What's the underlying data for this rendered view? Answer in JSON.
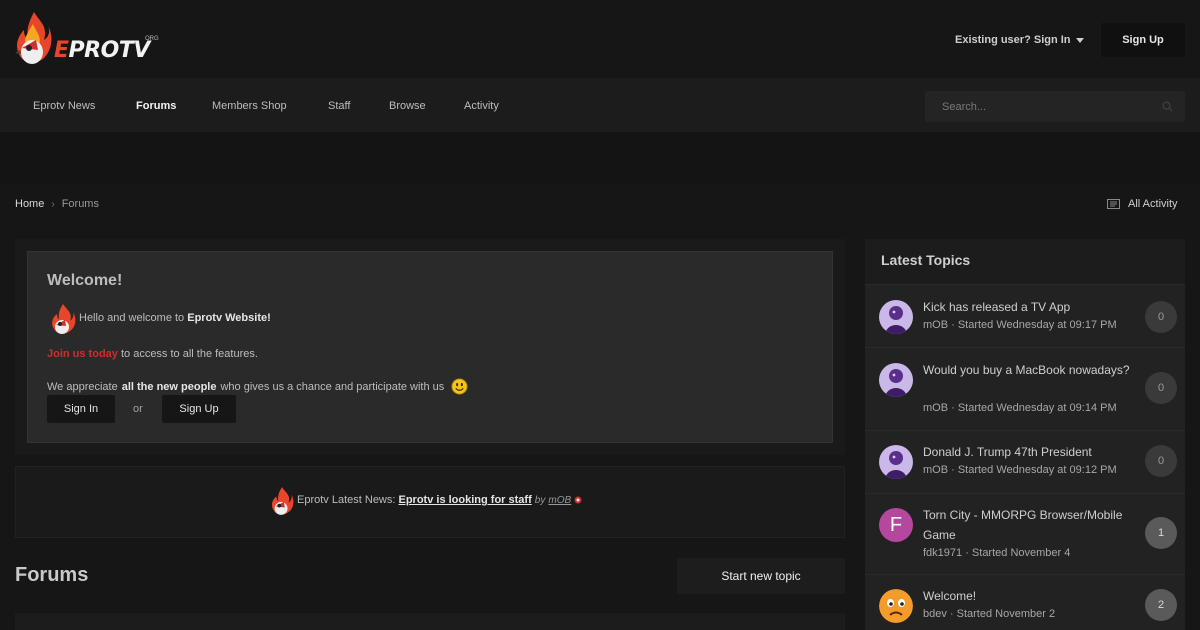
{
  "header": {
    "logo_text": "EPROTV",
    "logo_suffix": "ORG",
    "existing_user": "Existing user? Sign In",
    "signup": "Sign Up"
  },
  "nav": {
    "items": [
      "Eprotv News",
      "Forums",
      "Members Shop",
      "Staff",
      "Browse",
      "Activity"
    ],
    "active": "Forums",
    "search_placeholder": "Search..."
  },
  "breadcrumb": {
    "home": "Home",
    "current": "Forums",
    "all_activity": "All Activity"
  },
  "welcome": {
    "title": "Welcome!",
    "line1_prefix": "Hello and welcome to",
    "line1_bold": "Eprotv Website!",
    "join_link": "Join us today",
    "line2_rest": "to access to all the features.",
    "line3_prefix": "We appreciate",
    "line3_bold": "all the new people",
    "line3_rest": "who gives us a chance and participate with us",
    "signin_button": "Sign In",
    "or": "or",
    "signup_button": "Sign Up"
  },
  "news": {
    "prefix": "Eprotv Latest News:",
    "link": "Eprotv is looking for staff",
    "by": "by",
    "author": "mOB"
  },
  "forums": {
    "heading": "Forums",
    "start_topic": "Start new topic"
  },
  "sidebar": {
    "heading": "Latest Topics",
    "topics": [
      {
        "title": "Kick has released a TV App",
        "meta": "mOB · Started Wednesday at 09:17 PM",
        "count": "0",
        "avatar": "purple-figure"
      },
      {
        "title": "Would you buy a MacBook nowadays?",
        "meta": "mOB · Started Wednesday at 09:14 PM",
        "count": "0",
        "avatar": "purple-figure"
      },
      {
        "title": "Donald J. Trump 47th President",
        "meta": "mOB · Started Wednesday at 09:12 PM",
        "count": "0",
        "avatar": "purple-figure"
      },
      {
        "title": "Torn City - MMORPG Browser/Mobile Game",
        "meta": "fdk1971 · Started November 4",
        "count": "1",
        "avatar": "F",
        "avatar_color": "#b5489e"
      },
      {
        "title": "Welcome!",
        "meta": "bdev · Started November 2",
        "count": "2",
        "avatar": "emoji-face"
      }
    ]
  },
  "colors": {
    "background": "#161616",
    "accent_red": "#d12d2d"
  }
}
